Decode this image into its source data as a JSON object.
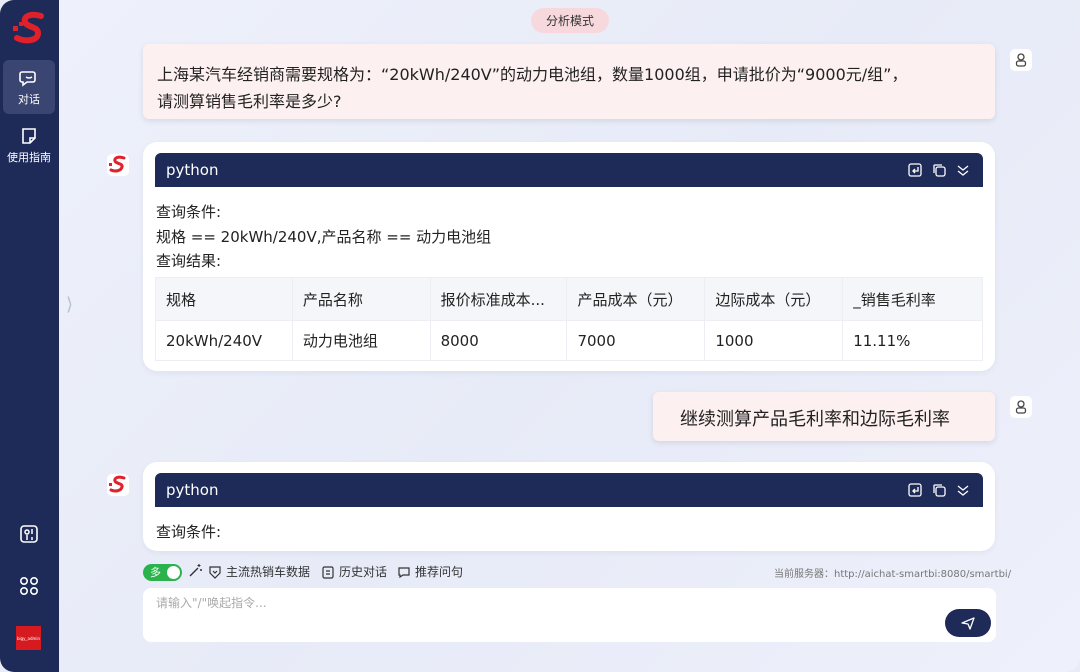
{
  "sidebar": {
    "items": [
      {
        "label": "对话",
        "icon": "chat-icon"
      },
      {
        "label": "使用指南",
        "icon": "guide-icon"
      }
    ],
    "bottom_icons": [
      "toolbox-icon",
      "apps-grid-icon"
    ],
    "user_badge": "bigy_admin"
  },
  "header": {
    "mode_label": "分析模式"
  },
  "conversation": {
    "q1": {
      "line1": "上海某汽车经销商需要规格为：“20kWh/240V”的动力电池组，数量1000组，申请批价为“9000元/组”，",
      "line2": "请测算销售毛利率是多少?"
    },
    "a1": {
      "lang": "python",
      "cond_label": "查询条件:",
      "cond_value": "规格 == 20kWh/240V,产品名称 == 动力电池组",
      "result_label": "查询结果:",
      "table": {
        "headers": [
          "规格",
          "产品名称",
          "报价标准成本...",
          "产品成本（元）",
          "边际成本（元）",
          "_销售毛利率"
        ],
        "rows": [
          [
            "20kWh/240V",
            "动力电池组",
            "8000",
            "7000",
            "1000",
            "11.11%"
          ]
        ]
      }
    },
    "q2": {
      "text": "继续测算产品毛利率和边际毛利率"
    },
    "a2": {
      "lang": "python",
      "cond_label": "查询条件:"
    }
  },
  "toolbar": {
    "toggle_label": "多",
    "items": [
      "主流热销车数据",
      "历史对话",
      "推荐问句"
    ],
    "server": "当前服务器：http://aichat-smartbi:8080/smartbi/"
  },
  "input": {
    "placeholder": "请输入\"/\"唤起指令..."
  },
  "colors": {
    "sidebar": "#1e2a57",
    "accent_red": "#d71920",
    "user_bubble": "#fdf0f0",
    "toggle_on": "#2bb24c"
  }
}
